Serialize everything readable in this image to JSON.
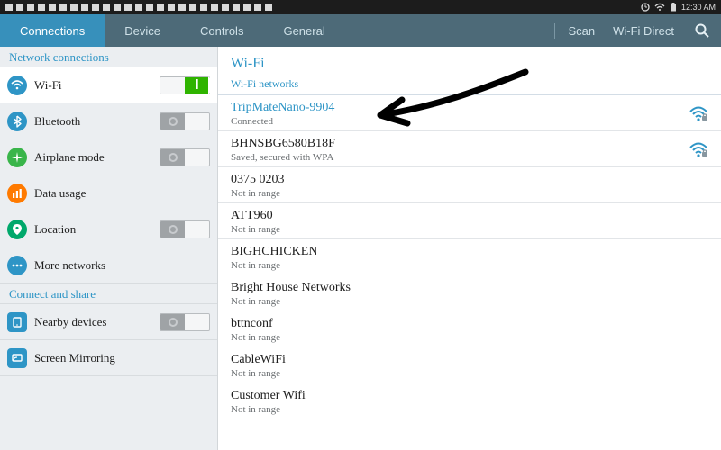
{
  "statusbar": {
    "time": "12:30 AM"
  },
  "tabs": {
    "connections": "Connections",
    "device": "Device",
    "controls": "Controls",
    "general": "General",
    "scan": "Scan",
    "wifidirect": "Wi-Fi Direct"
  },
  "sidebar": {
    "section_network": "Network connections",
    "wifi": "Wi-Fi",
    "bluetooth": "Bluetooth",
    "airplane": "Airplane mode",
    "datausage": "Data usage",
    "location": "Location",
    "morenetworks": "More networks",
    "section_connect": "Connect and share",
    "nearby": "Nearby devices",
    "mirroring": "Screen Mirroring"
  },
  "content": {
    "title": "Wi-Fi",
    "subtitle": "Wi-Fi networks",
    "networks": [
      {
        "ssid": "TripMateNano-9904",
        "status": "Connected"
      },
      {
        "ssid": "BHNSBG6580B18F",
        "status": "Saved, secured with WPA"
      },
      {
        "ssid": "0375 0203",
        "status": "Not in range"
      },
      {
        "ssid": "ATT960",
        "status": "Not in range"
      },
      {
        "ssid": "BIGHCHICKEN",
        "status": "Not in range"
      },
      {
        "ssid": "Bright House Networks",
        "status": "Not in range"
      },
      {
        "ssid": "bttnconf",
        "status": "Not in range"
      },
      {
        "ssid": "CableWiFi",
        "status": "Not in range"
      },
      {
        "ssid": "Customer Wifi",
        "status": "Not in range"
      }
    ]
  },
  "colors": {
    "accent": "#2e95c6",
    "tabbar": "#4d6a78",
    "tab_active": "#3790bb",
    "toggle_on": "#2fb400"
  }
}
